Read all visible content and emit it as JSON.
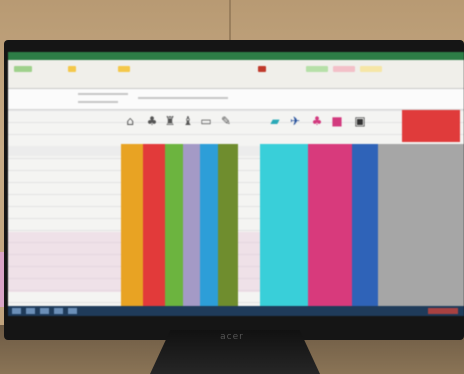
{
  "scene": "photo of a monitor showing a spreadsheet",
  "monitor_brand": "acer",
  "colors": {
    "orange": "#e8a323",
    "red": "#e23a3a",
    "green": "#6cb43f",
    "lavender": "#a49ac6",
    "blue": "#2d9ed8",
    "olive": "#6f8d2e",
    "cyan": "#39cfd9",
    "magenta": "#d83a7c",
    "royal": "#2f63b8",
    "gray": "#9a9a9a"
  },
  "icons": [
    "house-icon",
    "tree-icon",
    "mower-icon",
    "chair-icon",
    "grill-icon",
    "brush-icon",
    "boat-icon",
    "plane-icon",
    "bike-icon",
    "suitcase-icon",
    "printer-icon"
  ]
}
